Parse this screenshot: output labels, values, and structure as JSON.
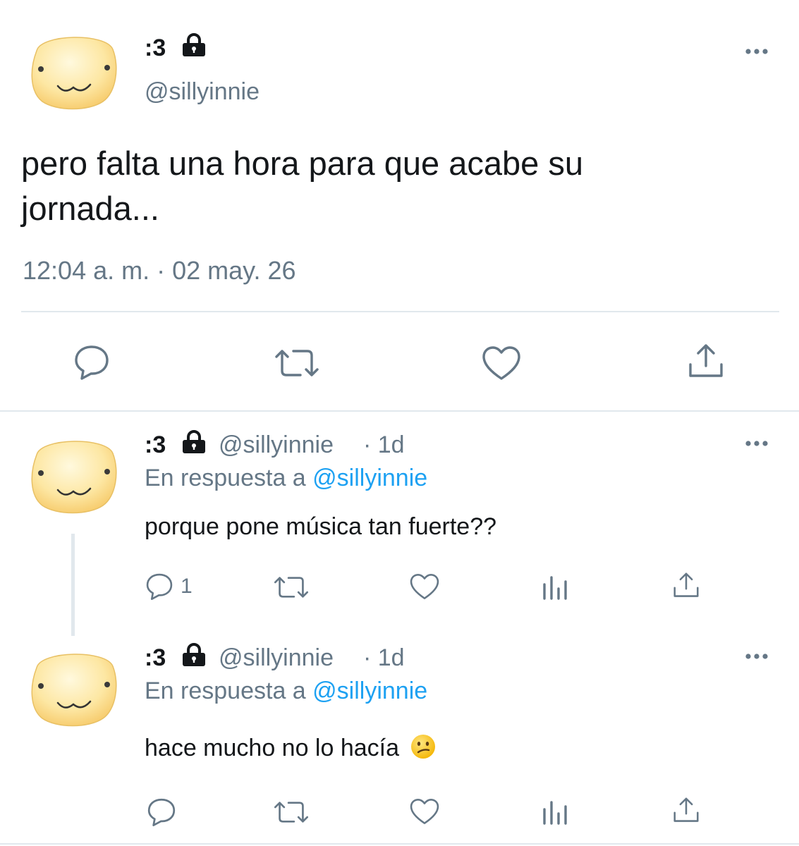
{
  "main_tweet": {
    "display_name": ":3",
    "handle": "@sillyinnie",
    "text_line1": "pero falta una hora para que acabe su",
    "text_line2": "jornada...",
    "timestamp": "12:04 a. m. · 02 may. 26"
  },
  "replies": [
    {
      "display_name": ":3",
      "handle": "@sillyinnie",
      "age": "· 1d",
      "reply_prefix": "En respuesta a",
      "reply_to": "@sillyinnie",
      "text": "porque pone música tan fuerte??",
      "reply_count": "1"
    },
    {
      "display_name": ":3",
      "handle": "@sillyinnie",
      "age": "· 1d",
      "reply_prefix": "En respuesta a",
      "reply_to": "@sillyinnie",
      "text": "hace mucho no lo hacía",
      "emoji": "😕",
      "reply_count": ""
    }
  ],
  "icons": {
    "lock": "lock-icon",
    "more": "more-horizontal-icon",
    "reply": "reply-icon",
    "retweet": "retweet-icon",
    "like": "heart-icon",
    "share": "share-icon",
    "analytics": "analytics-icon"
  },
  "colors": {
    "text": "#14171a",
    "secondary": "#657786",
    "link": "#1da1f2",
    "divider": "#e1e8ed",
    "avatar_fill": "#fde8a6"
  }
}
